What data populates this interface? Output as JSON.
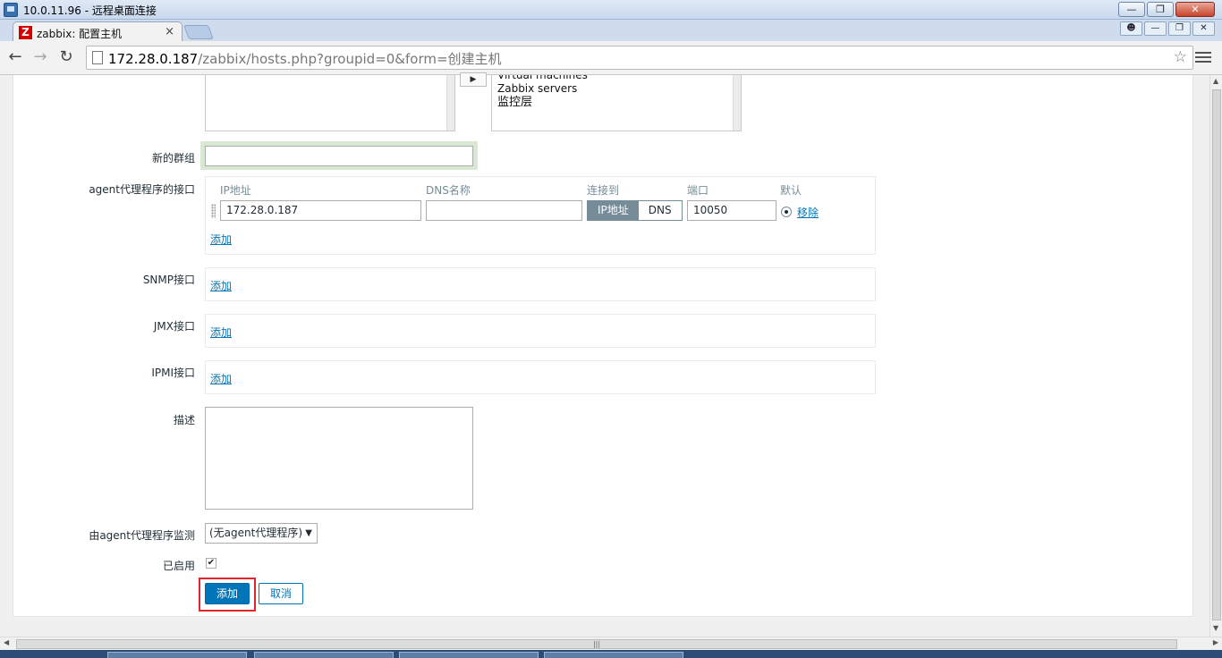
{
  "window": {
    "title": "10.0.11.96 - 远程桌面连接"
  },
  "browser": {
    "tab_title": "zabbix: 配置主机",
    "favicon_letter": "Z",
    "url_host": "172.28.0.187",
    "url_path": "/zabbix/hosts.php?groupid=0&form=创建主机"
  },
  "form": {
    "groups_list": [
      "Virtual machines",
      "Zabbix servers",
      "监控层"
    ],
    "new_group_label": "新的群组",
    "new_group_value": "",
    "agent_label": "agent代理程序的接口",
    "agent_headers": {
      "ip": "IP地址",
      "dns": "DNS名称",
      "connect": "连接到",
      "port": "端口",
      "default": "默认"
    },
    "agent_row": {
      "ip": "172.28.0.187",
      "dns": "",
      "connect_ip": "IP地址",
      "connect_dns": "DNS",
      "port": "10050",
      "remove": "移除"
    },
    "add_link": "添加",
    "snmp_label": "SNMP接口",
    "jmx_label": "JMX接口",
    "ipmi_label": "IPMI接口",
    "description_label": "描述",
    "description_value": "",
    "proxy_label": "由agent代理程序监测",
    "proxy_value": "(无agent代理程序)",
    "enabled_label": "已启用",
    "enabled_checked": true,
    "submit_label": "添加",
    "cancel_label": "取消"
  }
}
